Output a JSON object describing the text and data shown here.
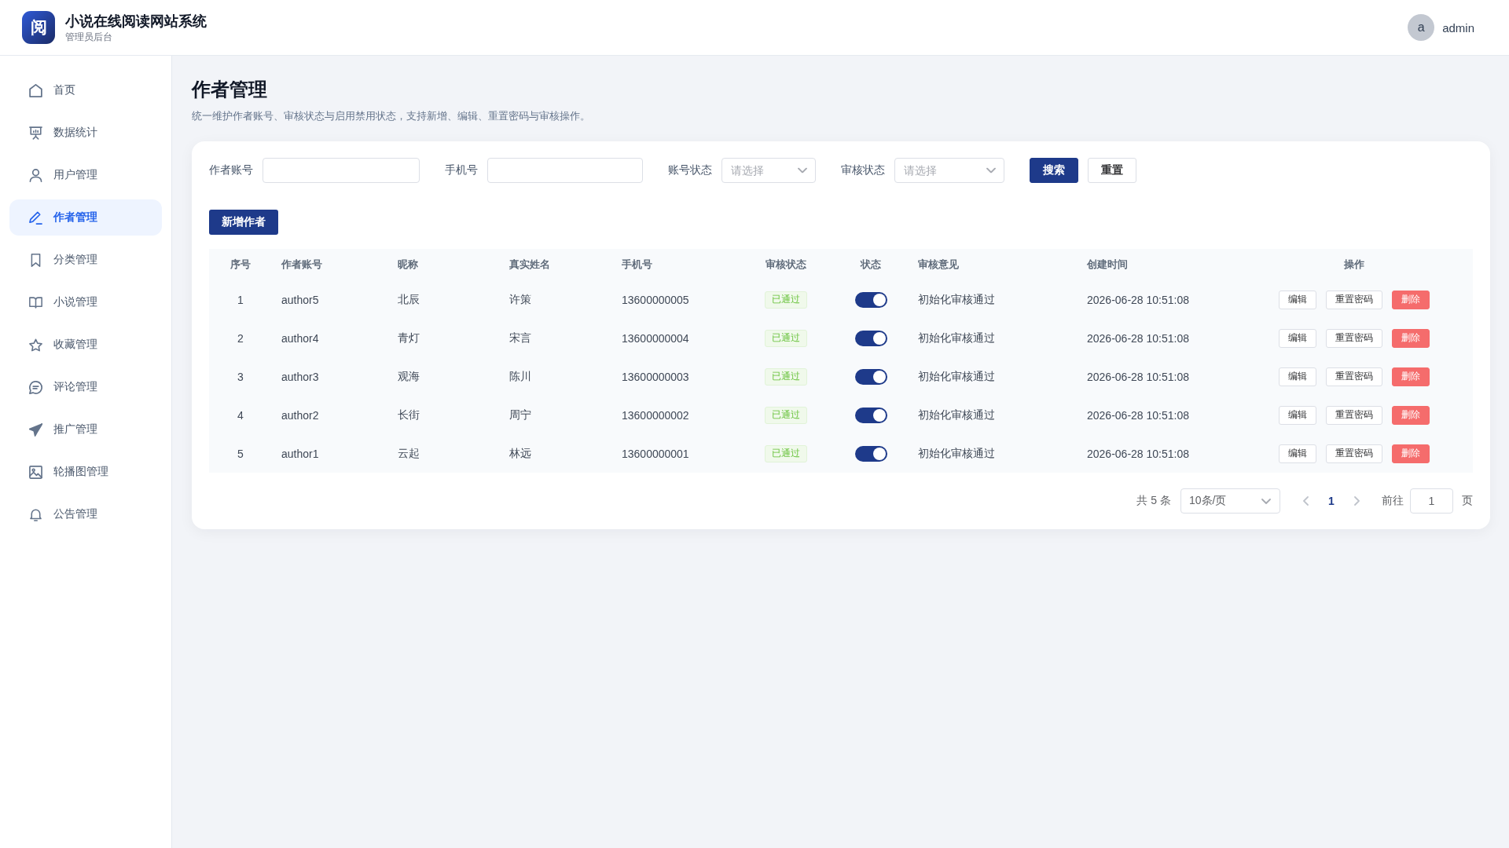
{
  "header": {
    "logo_text": "阅",
    "title": "小说在线阅读网站系统",
    "subtitle": "管理员后台",
    "user": {
      "avatar_letter": "a",
      "name": "admin"
    }
  },
  "sidebar": {
    "items": [
      {
        "label": "首页",
        "selected": false
      },
      {
        "label": "数据统计",
        "selected": false
      },
      {
        "label": "用户管理",
        "selected": false
      },
      {
        "label": "作者管理",
        "selected": true
      },
      {
        "label": "分类管理",
        "selected": false
      },
      {
        "label": "小说管理",
        "selected": false
      },
      {
        "label": "收藏管理",
        "selected": false
      },
      {
        "label": "评论管理",
        "selected": false
      },
      {
        "label": "推广管理",
        "selected": false
      },
      {
        "label": "轮播图管理",
        "selected": false
      },
      {
        "label": "公告管理",
        "selected": false
      }
    ]
  },
  "page": {
    "title": "作者管理",
    "description": "统一维护作者账号、审核状态与启用禁用状态，支持新增、编辑、重置密码与审核操作。"
  },
  "filters": {
    "fields": [
      {
        "kind": "input",
        "label": "作者账号"
      },
      {
        "kind": "input",
        "label": "手机号"
      },
      {
        "kind": "select",
        "label": "账号状态",
        "placeholder": "请选择"
      },
      {
        "kind": "select",
        "label": "审核状态",
        "placeholder": "请选择"
      }
    ],
    "buttons": [
      {
        "kind": "primary",
        "label": "搜索"
      },
      {
        "kind": "default",
        "label": "重置"
      }
    ]
  },
  "add_button": "新增作者",
  "table": {
    "columns": [
      "序号",
      "作者账号",
      "昵称",
      "真实姓名",
      "手机号",
      "审核状态",
      "状态",
      "审核意见",
      "创建时间",
      "操作"
    ],
    "rows": [
      {
        "index": "1",
        "account": "author5",
        "nickname": "北辰",
        "real_name": "许策",
        "phone": "13600000005",
        "review_status": "已通过",
        "enabled": true,
        "review_comment": "初始化审核通过",
        "created_at": "2026-06-28 10:51:08",
        "actions": [
          {
            "kind": "default",
            "label": "编辑"
          },
          {
            "kind": "default",
            "label": "重置密码"
          },
          {
            "kind": "danger",
            "label": "删除"
          }
        ]
      },
      {
        "index": "2",
        "account": "author4",
        "nickname": "青灯",
        "real_name": "宋言",
        "phone": "13600000004",
        "review_status": "已通过",
        "enabled": true,
        "review_comment": "初始化审核通过",
        "created_at": "2026-06-28 10:51:08",
        "actions": [
          {
            "kind": "default",
            "label": "编辑"
          },
          {
            "kind": "default",
            "label": "重置密码"
          },
          {
            "kind": "danger",
            "label": "删除"
          }
        ]
      },
      {
        "index": "3",
        "account": "author3",
        "nickname": "观海",
        "real_name": "陈川",
        "phone": "13600000003",
        "review_status": "已通过",
        "enabled": true,
        "review_comment": "初始化审核通过",
        "created_at": "2026-06-28 10:51:08",
        "actions": [
          {
            "kind": "default",
            "label": "编辑"
          },
          {
            "kind": "default",
            "label": "重置密码"
          },
          {
            "kind": "danger",
            "label": "删除"
          }
        ]
      },
      {
        "index": "4",
        "account": "author2",
        "nickname": "长街",
        "real_name": "周宁",
        "phone": "13600000002",
        "review_status": "已通过",
        "enabled": true,
        "review_comment": "初始化审核通过",
        "created_at": "2026-06-28 10:51:08",
        "actions": [
          {
            "kind": "default",
            "label": "编辑"
          },
          {
            "kind": "default",
            "label": "重置密码"
          },
          {
            "kind": "danger",
            "label": "删除"
          }
        ]
      },
      {
        "index": "5",
        "account": "author1",
        "nickname": "云起",
        "real_name": "林远",
        "phone": "13600000001",
        "review_status": "已通过",
        "enabled": true,
        "review_comment": "初始化审核通过",
        "created_at": "2026-06-28 10:51:08",
        "actions": [
          {
            "kind": "default",
            "label": "编辑"
          },
          {
            "kind": "default",
            "label": "重置密码"
          },
          {
            "kind": "danger",
            "label": "删除"
          }
        ]
      }
    ]
  },
  "pagination": {
    "total": "共 5 条",
    "page_size": "10条/页",
    "prev_disabled": true,
    "pages": [
      {
        "label": "1",
        "selected": true
      }
    ],
    "next_disabled": true,
    "goto_label": "前往",
    "goto_value": "1",
    "goto_suffix": "页"
  }
}
